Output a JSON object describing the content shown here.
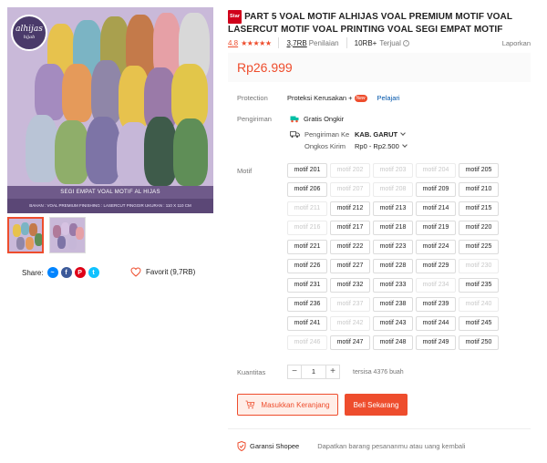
{
  "product": {
    "badge": "Star",
    "title": "PART 5 VOAL MOTIF ALHIJAS VOAL PREMIUM MOTIF VOAL LASERCUT MOTIF VOAL PRINTING VOAL SEGI EMPAT MOTIF",
    "rating": "4.8",
    "stars": "★★★★★",
    "review_count": "3,7RB",
    "review_label": "Penilaian",
    "sold_count": "10RB+",
    "sold_label": "Terjual",
    "report_label": "Laporkan",
    "price": "Rp26.999"
  },
  "image": {
    "logo_text": "alhijas",
    "logo_sub": "hijab",
    "banner_text": "SEGI EMPAT VOAL MOTIF AL HIJAS",
    "sub_banner_text": "BAHAN : VOAL PREMIUM   FINISHING : LASERCUT PINGGIR   UKURAN : 110 X 110 CM"
  },
  "share": {
    "label": "Share:",
    "icons": [
      "messenger-icon",
      "facebook-icon",
      "pinterest-icon",
      "twitter-icon"
    ]
  },
  "favorite": {
    "label": "Favorit (9,7RB)"
  },
  "protection": {
    "label": "Protection",
    "name": "Proteksi Kerusakan +",
    "new_badge": "New",
    "link": "Pelajari"
  },
  "shipping": {
    "label": "Pengiriman",
    "free": "Gratis Ongkir",
    "to_label": "Pengiriman Ke",
    "to_value": "KAB. GARUT",
    "cost_label": "Ongkos Kirim",
    "cost_value": "Rp0 - Rp2.500"
  },
  "variations": {
    "label": "Motif",
    "options": [
      {
        "label": "motif 201",
        "enabled": true
      },
      {
        "label": "motif 202",
        "enabled": false
      },
      {
        "label": "motif 203",
        "enabled": false
      },
      {
        "label": "motif 204",
        "enabled": false
      },
      {
        "label": "motif 205",
        "enabled": true
      },
      {
        "label": "motif 206",
        "enabled": true
      },
      {
        "label": "motif 207",
        "enabled": false
      },
      {
        "label": "motif 208",
        "enabled": false
      },
      {
        "label": "motif 209",
        "enabled": true
      },
      {
        "label": "motif 210",
        "enabled": true
      },
      {
        "label": "motif 211",
        "enabled": false
      },
      {
        "label": "motif 212",
        "enabled": true
      },
      {
        "label": "motif 213",
        "enabled": true
      },
      {
        "label": "motif 214",
        "enabled": true
      },
      {
        "label": "motif 215",
        "enabled": true
      },
      {
        "label": "motif 216",
        "enabled": false
      },
      {
        "label": "motif 217",
        "enabled": true
      },
      {
        "label": "motif 218",
        "enabled": true
      },
      {
        "label": "motif 219",
        "enabled": true
      },
      {
        "label": "motif 220",
        "enabled": true
      },
      {
        "label": "motif 221",
        "enabled": true
      },
      {
        "label": "motif 222",
        "enabled": true
      },
      {
        "label": "motif 223",
        "enabled": true
      },
      {
        "label": "motif 224",
        "enabled": true
      },
      {
        "label": "motif 225",
        "enabled": true
      },
      {
        "label": "motif 226",
        "enabled": true
      },
      {
        "label": "motif 227",
        "enabled": true
      },
      {
        "label": "motif 228",
        "enabled": true
      },
      {
        "label": "motif 229",
        "enabled": true
      },
      {
        "label": "motif 230",
        "enabled": false
      },
      {
        "label": "motif 231",
        "enabled": true
      },
      {
        "label": "motif 232",
        "enabled": true
      },
      {
        "label": "motif 233",
        "enabled": true
      },
      {
        "label": "motif 234",
        "enabled": false
      },
      {
        "label": "motif 235",
        "enabled": true
      },
      {
        "label": "motif 236",
        "enabled": true
      },
      {
        "label": "motif 237",
        "enabled": false
      },
      {
        "label": "motif 238",
        "enabled": true
      },
      {
        "label": "motif 239",
        "enabled": true
      },
      {
        "label": "motif 240",
        "enabled": false
      },
      {
        "label": "motif 241",
        "enabled": true
      },
      {
        "label": "motif 242",
        "enabled": false
      },
      {
        "label": "motif 243",
        "enabled": true
      },
      {
        "label": "motif 244",
        "enabled": true
      },
      {
        "label": "motif 245",
        "enabled": true
      },
      {
        "label": "motif 246",
        "enabled": false
      },
      {
        "label": "motif 247",
        "enabled": true
      },
      {
        "label": "motif 248",
        "enabled": true
      },
      {
        "label": "motif 249",
        "enabled": true
      },
      {
        "label": "motif 250",
        "enabled": true
      }
    ]
  },
  "quantity": {
    "label": "Kuantitas",
    "minus": "−",
    "value": "1",
    "plus": "+",
    "stock": "tersisa 4376 buah"
  },
  "actions": {
    "cart": "Masukkan Keranjang",
    "buy": "Beli Sekarang"
  },
  "guarantee": {
    "title": "Garansi Shopee",
    "desc": "Dapatkan barang pesananmu atau uang kembali"
  },
  "colors": {
    "accent": "#ee4d2d",
    "link": "#0055aa"
  }
}
